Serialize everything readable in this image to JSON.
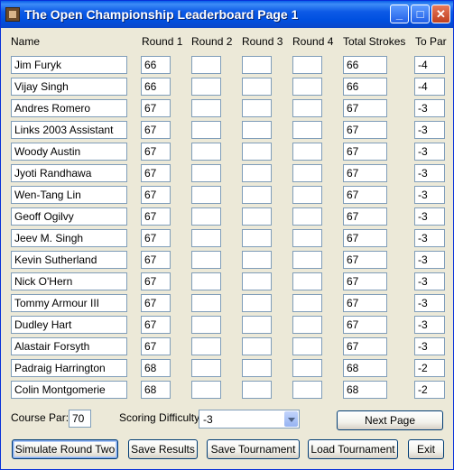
{
  "window": {
    "title": "The Open Championship Leaderboard Page 1"
  },
  "headers": {
    "name": "Name",
    "round1": "Round 1",
    "round2": "Round 2",
    "round3": "Round 3",
    "round4": "Round 4",
    "total": "Total Strokes",
    "topar": "To Par"
  },
  "rows": [
    {
      "name": "Jim Furyk",
      "r1": "66",
      "r2": "",
      "r3": "",
      "r4": "",
      "total": "66",
      "topar": "-4"
    },
    {
      "name": "Vijay Singh",
      "r1": "66",
      "r2": "",
      "r3": "",
      "r4": "",
      "total": "66",
      "topar": "-4"
    },
    {
      "name": "Andres Romero",
      "r1": "67",
      "r2": "",
      "r3": "",
      "r4": "",
      "total": "67",
      "topar": "-3"
    },
    {
      "name": "Links 2003 Assistant",
      "r1": "67",
      "r2": "",
      "r3": "",
      "r4": "",
      "total": "67",
      "topar": "-3"
    },
    {
      "name": "Woody Austin",
      "r1": "67",
      "r2": "",
      "r3": "",
      "r4": "",
      "total": "67",
      "topar": "-3"
    },
    {
      "name": "Jyoti Randhawa",
      "r1": "67",
      "r2": "",
      "r3": "",
      "r4": "",
      "total": "67",
      "topar": "-3"
    },
    {
      "name": "Wen-Tang Lin",
      "r1": "67",
      "r2": "",
      "r3": "",
      "r4": "",
      "total": "67",
      "topar": "-3"
    },
    {
      "name": "Geoff Ogilvy",
      "r1": "67",
      "r2": "",
      "r3": "",
      "r4": "",
      "total": "67",
      "topar": "-3"
    },
    {
      "name": "Jeev M. Singh",
      "r1": "67",
      "r2": "",
      "r3": "",
      "r4": "",
      "total": "67",
      "topar": "-3"
    },
    {
      "name": "Kevin Sutherland",
      "r1": "67",
      "r2": "",
      "r3": "",
      "r4": "",
      "total": "67",
      "topar": "-3"
    },
    {
      "name": "Nick O'Hern",
      "r1": "67",
      "r2": "",
      "r3": "",
      "r4": "",
      "total": "67",
      "topar": "-3"
    },
    {
      "name": "Tommy Armour III",
      "r1": "67",
      "r2": "",
      "r3": "",
      "r4": "",
      "total": "67",
      "topar": "-3"
    },
    {
      "name": "Dudley Hart",
      "r1": "67",
      "r2": "",
      "r3": "",
      "r4": "",
      "total": "67",
      "topar": "-3"
    },
    {
      "name": "Alastair Forsyth",
      "r1": "67",
      "r2": "",
      "r3": "",
      "r4": "",
      "total": "67",
      "topar": "-3"
    },
    {
      "name": "Padraig Harrington",
      "r1": "68",
      "r2": "",
      "r3": "",
      "r4": "",
      "total": "68",
      "topar": "-2"
    },
    {
      "name": "Colin Montgomerie",
      "r1": "68",
      "r2": "",
      "r3": "",
      "r4": "",
      "total": "68",
      "topar": "-2"
    }
  ],
  "course_par": {
    "label": "Course Par:",
    "value": "70"
  },
  "difficulty": {
    "label": "Scoring Difficulty:",
    "value": "-3"
  },
  "buttons": {
    "next_page": "Next Page",
    "simulate": "Simulate Round Two",
    "save_results": "Save Results",
    "save_tournament": "Save Tournament",
    "load_tournament": "Load Tournament",
    "exit": "Exit"
  }
}
